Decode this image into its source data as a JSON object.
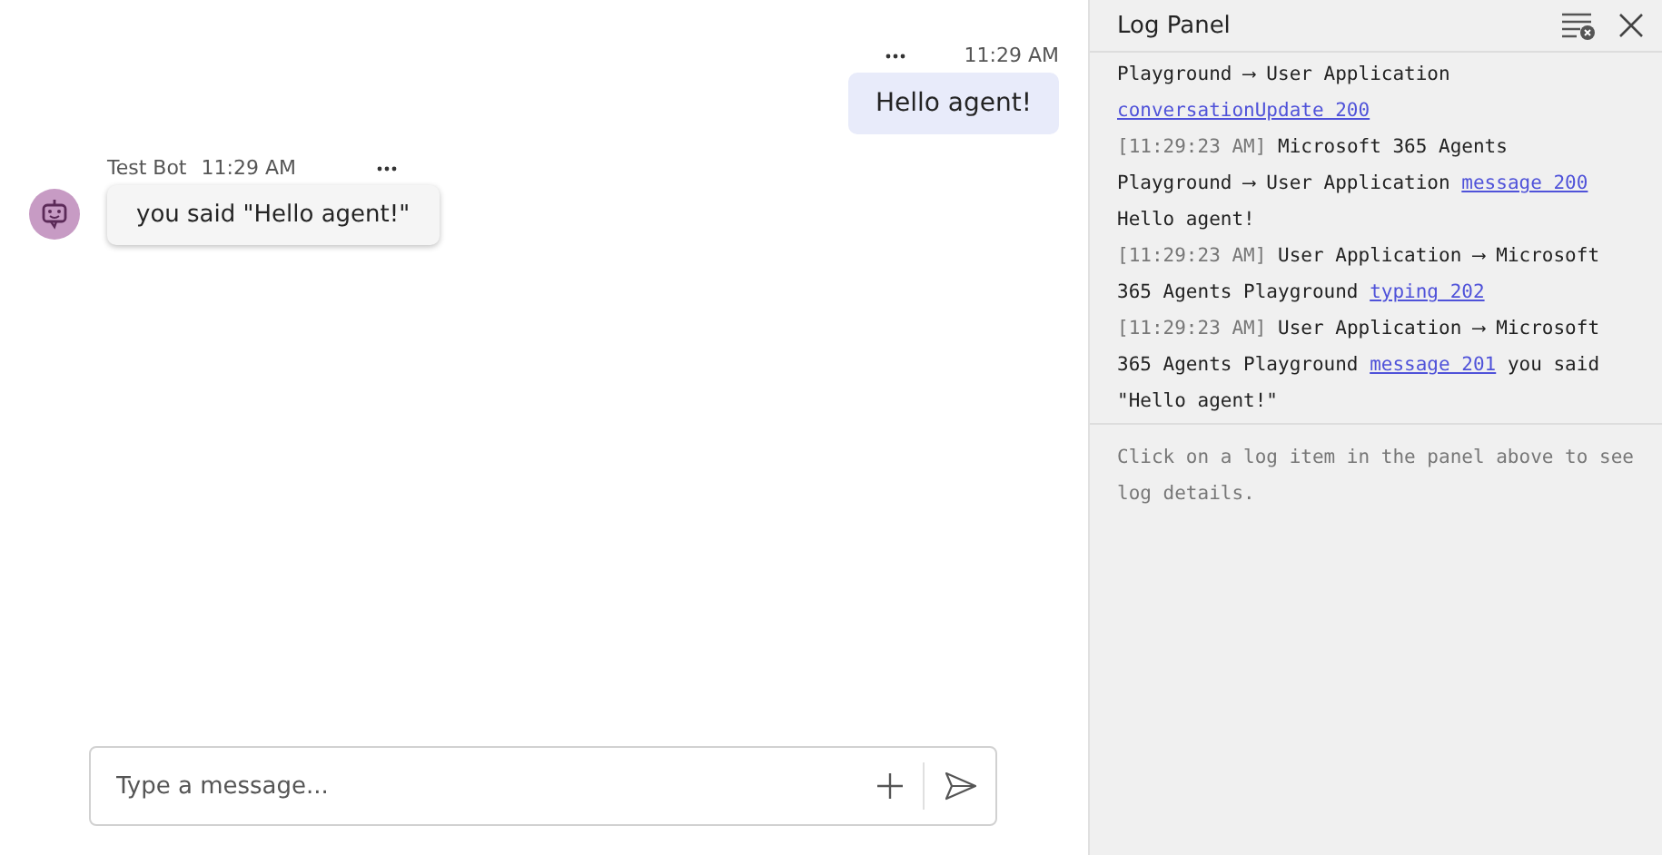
{
  "chat": {
    "messages": [
      {
        "kind": "user",
        "time": "11:29 AM",
        "text": "Hello agent!"
      },
      {
        "kind": "bot",
        "sender": "Test Bot",
        "time": "11:29 AM",
        "text": "you said \"Hello agent!\""
      }
    ],
    "composer": {
      "placeholder": "Type a message..."
    }
  },
  "log_panel": {
    "title": "Log Panel",
    "entries": [
      {
        "text": "Playground ⟶ User Application",
        "link": "conversationUpdate 200"
      },
      {
        "time": "[11:29:23 AM]",
        "text": "Microsoft 365 Agents Playground ⟶ User Application",
        "link": "message 200",
        "after": "Hello agent!"
      },
      {
        "time": "[11:29:23 AM]",
        "text": "User Application ⟶ Microsoft 365 Agents Playground",
        "link": "typing 202"
      },
      {
        "time": "[11:29:23 AM]",
        "text": "User Application ⟶ Microsoft 365 Agents Playground",
        "link": "message 201",
        "after": "you said \"Hello agent!\""
      }
    ],
    "hint": "Click on a log item in the panel above to see log details."
  }
}
